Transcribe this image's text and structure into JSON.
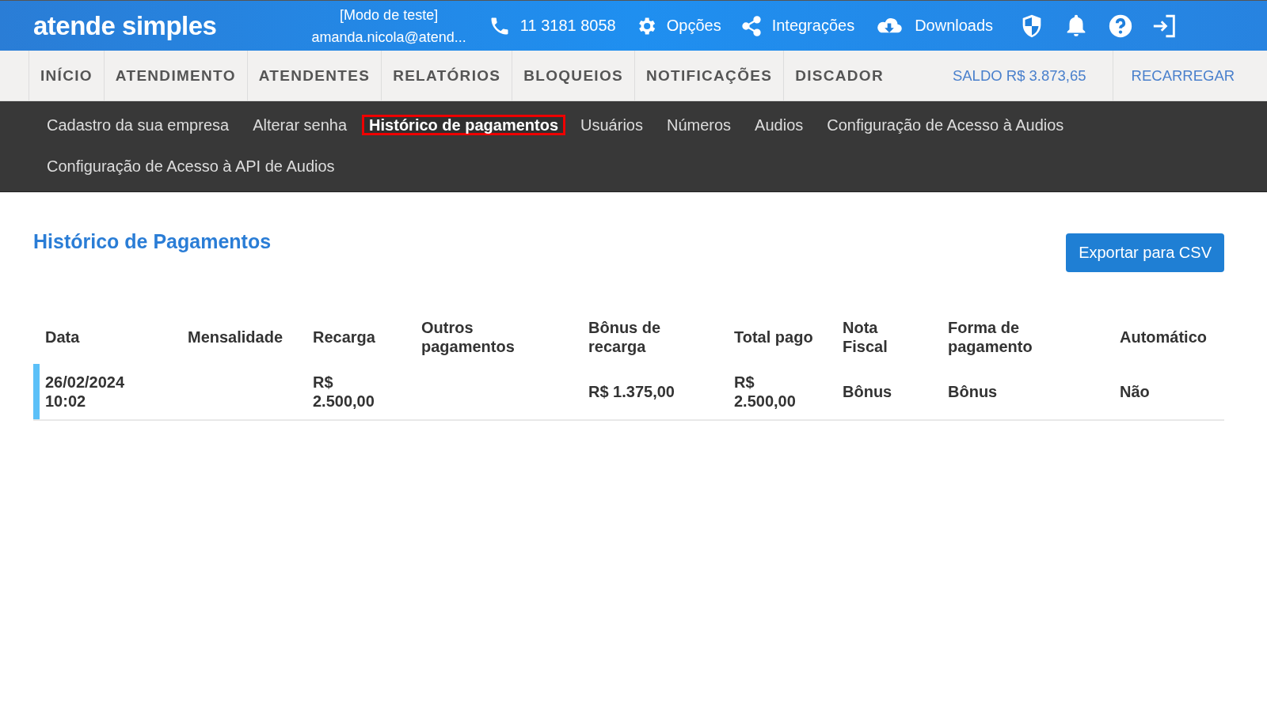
{
  "header": {
    "logo": "atende simples",
    "mode": "[Modo de teste]",
    "user": "amanda.nicola@atend...",
    "phone": "11 3181 8058",
    "links": [
      {
        "kind": "gear",
        "label": "Opções"
      },
      {
        "kind": "share",
        "label": "Integrações"
      },
      {
        "kind": "download",
        "label": "Downloads"
      }
    ],
    "icons": [
      {
        "kind": "shield"
      },
      {
        "kind": "bell"
      },
      {
        "kind": "help"
      },
      {
        "kind": "logout"
      }
    ]
  },
  "nav": {
    "items": [
      "INÍCIO",
      "ATENDIMENTO",
      "ATENDENTES",
      "RELATÓRIOS",
      "BLOQUEIOS",
      "NOTIFICAÇÕES",
      "DISCADOR"
    ],
    "balance": "SALDO R$ 3.873,65",
    "recharge": "RECARREGAR"
  },
  "subnav": [
    {
      "label": "Cadastro da sua empresa",
      "selected": false
    },
    {
      "label": "Alterar senha",
      "selected": false
    },
    {
      "label": "Histórico de pagamentos",
      "selected": true
    },
    {
      "label": "Usuários",
      "selected": false
    },
    {
      "label": "Números",
      "selected": false
    },
    {
      "label": "Audios",
      "selected": false
    },
    {
      "label": "Configuração de Acesso à Audios",
      "selected": false
    },
    {
      "label": "Configuração de Acesso à API de Audios",
      "selected": false
    }
  ],
  "page": {
    "title": "Histórico de Pagamentos",
    "export_button": "Exportar para CSV"
  },
  "table": {
    "columns": [
      "Data",
      "Mensalidade",
      "Recarga",
      "Outros pagamentos",
      "Bônus de recarga",
      "Total pago",
      "Nota Fiscal",
      "Forma de pagamento",
      "Automático"
    ],
    "rows": [
      {
        "selected": true,
        "cells": [
          "26/02/2024 10:02",
          "",
          "R$ 2.500,00",
          "",
          "R$ 1.375,00",
          "R$ 2.500,00",
          "Bônus",
          "Bônus",
          "Não"
        ]
      }
    ]
  }
}
